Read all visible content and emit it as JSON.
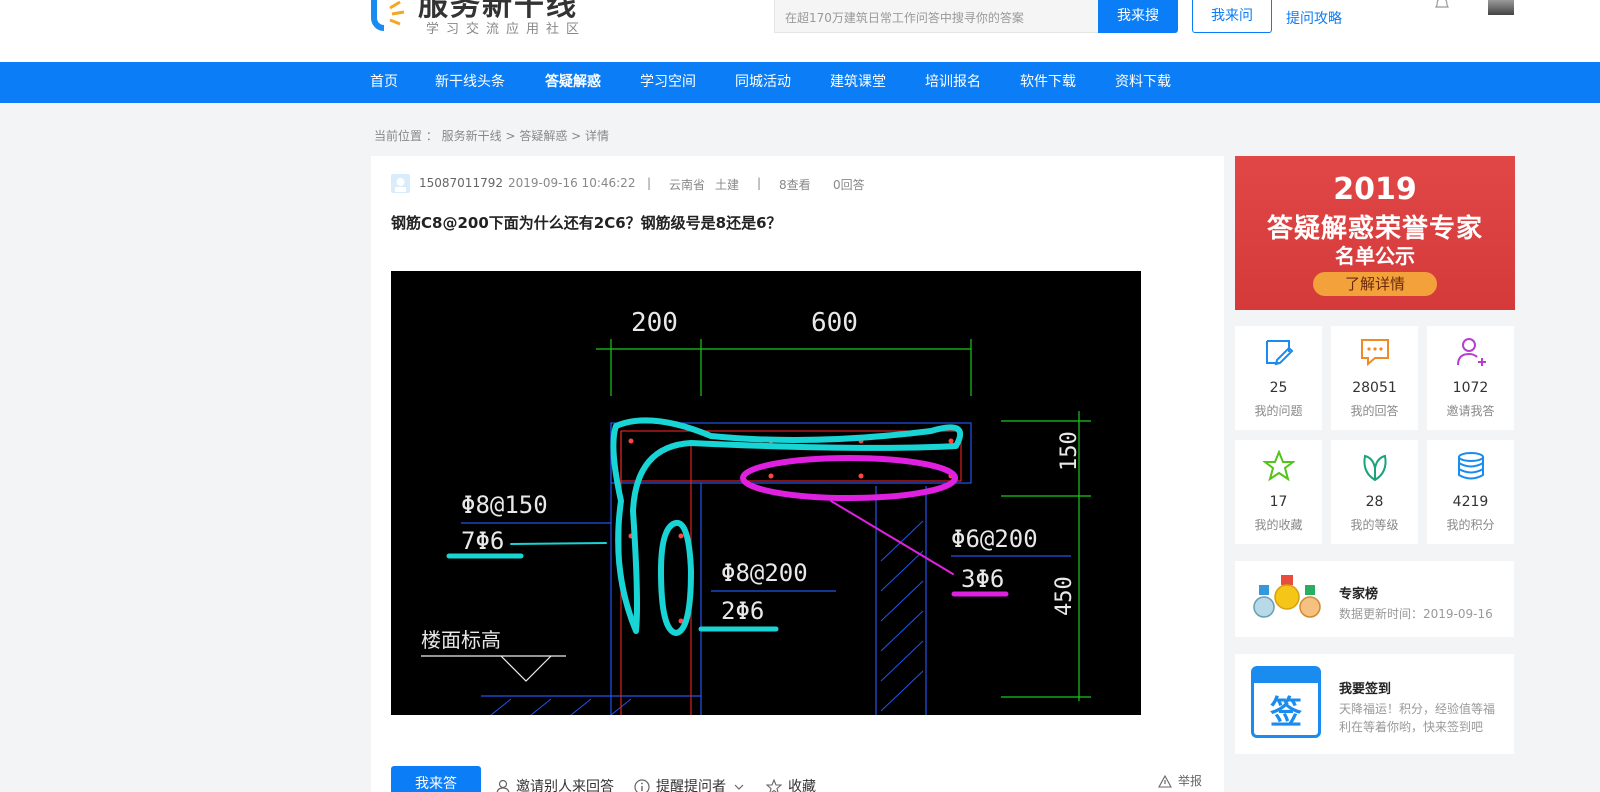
{
  "header": {
    "logo_title": "服务新干线",
    "logo_subtitle": "学习交流应用社区",
    "search_placeholder": "在超170万建筑日常工作问答中搜寻你的答案",
    "search_button": "我来搜",
    "ask_button": "我来问",
    "guide_link": "提问攻略"
  },
  "nav": [
    "首页",
    "新干线头条",
    "答疑解惑",
    "学习空间",
    "同城活动",
    "建筑课堂",
    "培训报名",
    "软件下载",
    "资料下载"
  ],
  "nav_active": "答疑解惑",
  "breadcrumb": "当前位置 ： 服务新干线 > 答疑解惑 > 详情",
  "question": {
    "user": "15087011792",
    "datetime": "2019-09-16 10:46:22",
    "sep": "|",
    "province": "云南省",
    "category": "土建",
    "views": "8查看",
    "answers": "0回答",
    "title": "钢筋C8@200下面为什么还有2C6？钢筋级号是8还是6？"
  },
  "drawing": {
    "dim1": "200",
    "dim2": "600",
    "dim3": "150",
    "dim4": "450",
    "label1": "Φ8@150",
    "label2": "7Φ6",
    "label3": "Φ8@200",
    "label4": "2Φ6",
    "label5": "Φ6@200",
    "label6": "3Φ6",
    "label7": "楼面标高"
  },
  "actions": {
    "answer_button": "我来答",
    "invite": "邀请别人来回答",
    "remind": "提醒提问者",
    "favorite": "收藏",
    "report": "举报"
  },
  "banner": {
    "year": "2019",
    "title": "答疑解惑荣誉专家",
    "subtitle": "名单公示",
    "button": "了解详情"
  },
  "stats": [
    {
      "icon": "edit-icon",
      "value": "25",
      "label": "我的问题",
      "color": "#1a8cf0"
    },
    {
      "icon": "chat-icon",
      "value": "28051",
      "label": "我的回答",
      "color": "#f08a24"
    },
    {
      "icon": "add-user-icon",
      "value": "1072",
      "label": "邀请我答",
      "color": "#b43fd1"
    },
    {
      "icon": "star-icon",
      "value": "17",
      "label": "我的收藏",
      "color": "#52c41a"
    },
    {
      "icon": "leaf-icon",
      "value": "28",
      "label": "我的等级",
      "color": "#1aa37a"
    },
    {
      "icon": "coins-icon",
      "value": "4219",
      "label": "我的积分",
      "color": "#1a8cf0"
    }
  ],
  "experts": {
    "title": "专家榜",
    "desc": "数据更新时间：2019-09-16"
  },
  "checkin": {
    "title": "我要签到",
    "desc": "天降福运！积分，经验值等福利在等着你哟，快来签到吧",
    "icon_char": "签"
  },
  "colors": {
    "brand": "#0a7df7",
    "banner": "#d94040"
  }
}
